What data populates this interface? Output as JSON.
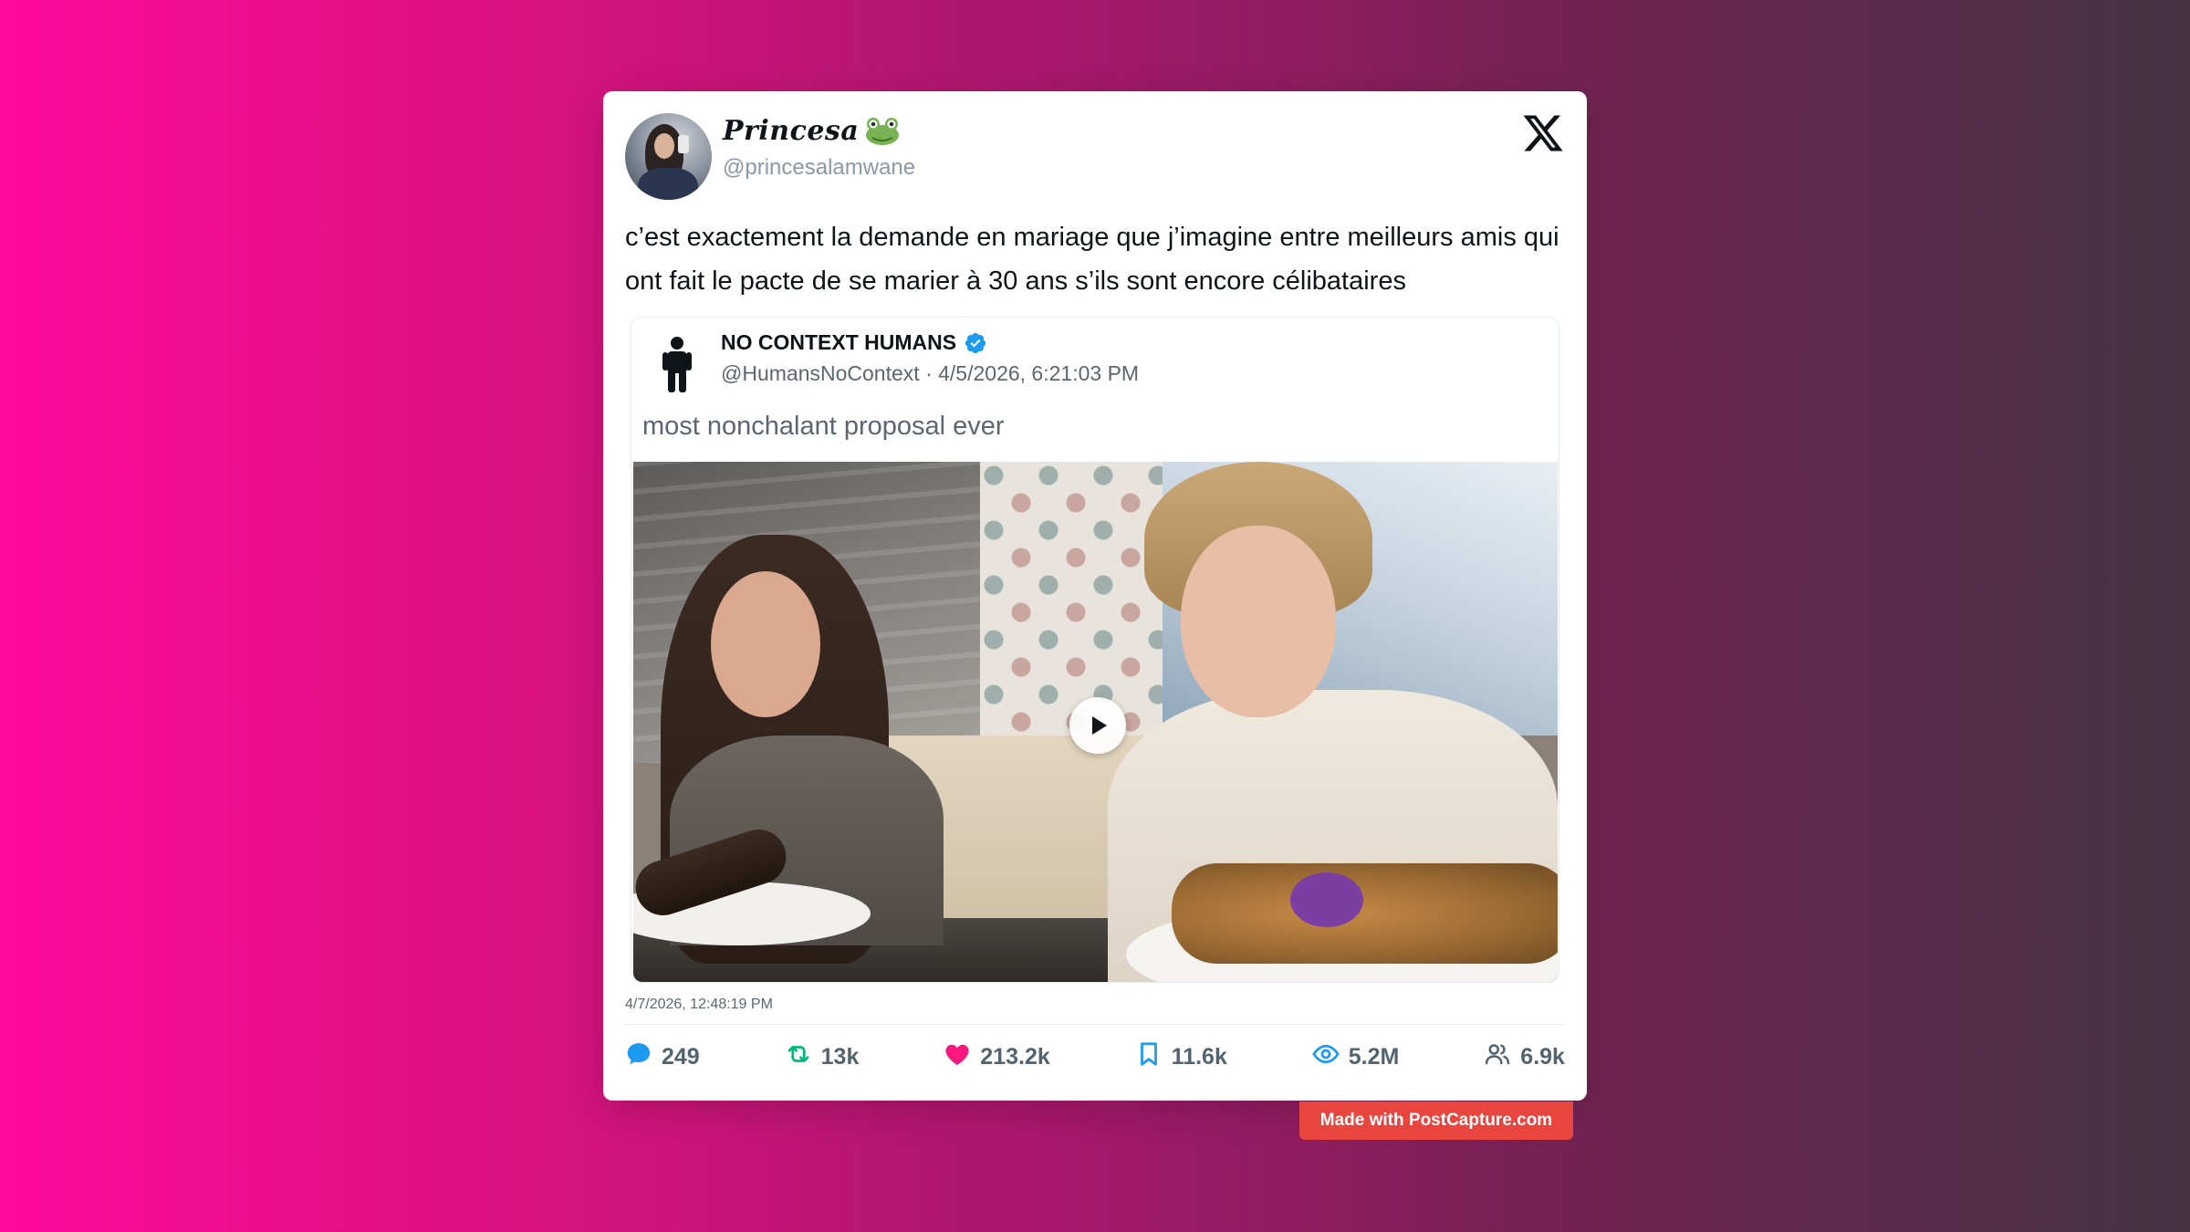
{
  "author": {
    "display_name": "Princesa",
    "emoji_icon": "frog-face-icon",
    "handle": "@princesalamwane"
  },
  "platform_icon": "x-logo-icon",
  "tweet": {
    "text": "c’est exactement la demande en mariage que j’imagine entre meilleurs amis qui ont fait le pacte de se marier à 30 ans s’ils sont encore célibataires",
    "timestamp": "4/7/2026, 12:48:19 PM"
  },
  "quoted_tweet": {
    "display_name": "NO CONTEXT HUMANS",
    "verified_icon": "verified-badge-icon",
    "handle": "@HumansNoContext",
    "separator": "·",
    "date": "4/5/2026, 6:21:03 PM",
    "text": "most nonchalant proposal ever",
    "media_type": "video",
    "play_icon": "play-icon"
  },
  "stats": {
    "replies": "249",
    "retweets": "13k",
    "likes": "213.2k",
    "bookmarks": "11.6k",
    "views": "5.2M",
    "quotes": "6.9k"
  },
  "colors": {
    "background_gradient_start": "#ff0a9c",
    "background_gradient_end": "#443341",
    "reply_icon": "#1d9bf0",
    "retweet_icon": "#00ba7c",
    "like_icon": "#f91880",
    "bookmark_icon": "#1d9bf0",
    "views_icon": "#1d9bf0",
    "badge": "#e8453f"
  },
  "watermark": "Made with PostCapture.com"
}
